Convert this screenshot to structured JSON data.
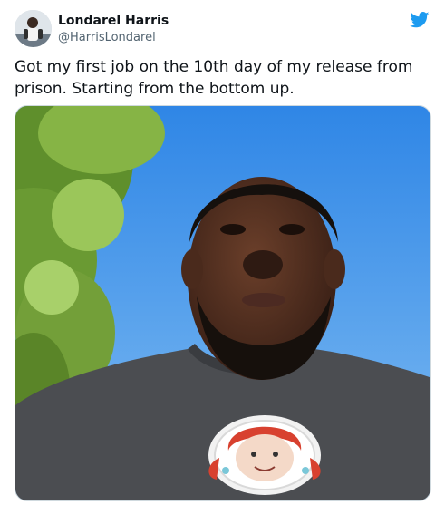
{
  "author": {
    "display_name": "Londarel Harris",
    "handle": "@HarrisLondarel"
  },
  "tweet": {
    "text": "Got my first job on the 10th day of my release from prison. Starting from the bottom up."
  },
  "icons": {
    "brand": "twitter-bird-icon"
  },
  "colors": {
    "brand_blue": "#1d9bf0",
    "text_primary": "#0f1419",
    "text_secondary": "#536471"
  }
}
